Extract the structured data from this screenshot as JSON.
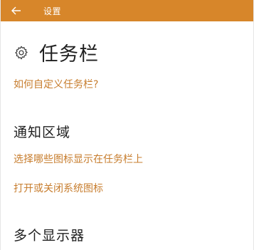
{
  "titlebar": {
    "title": "设置",
    "back_icon": "arrow-left-icon",
    "color": "#d7862a"
  },
  "page": {
    "icon": "gear-icon",
    "title": "任务栏",
    "help_link": "如何自定义任务栏?"
  },
  "sections": [
    {
      "title": "通知区域",
      "links": [
        "选择哪些图标显示在任务栏上",
        "打开或关闭系统图标"
      ]
    },
    {
      "title": "多个显示器"
    }
  ],
  "accent_color": "#c77d2e"
}
